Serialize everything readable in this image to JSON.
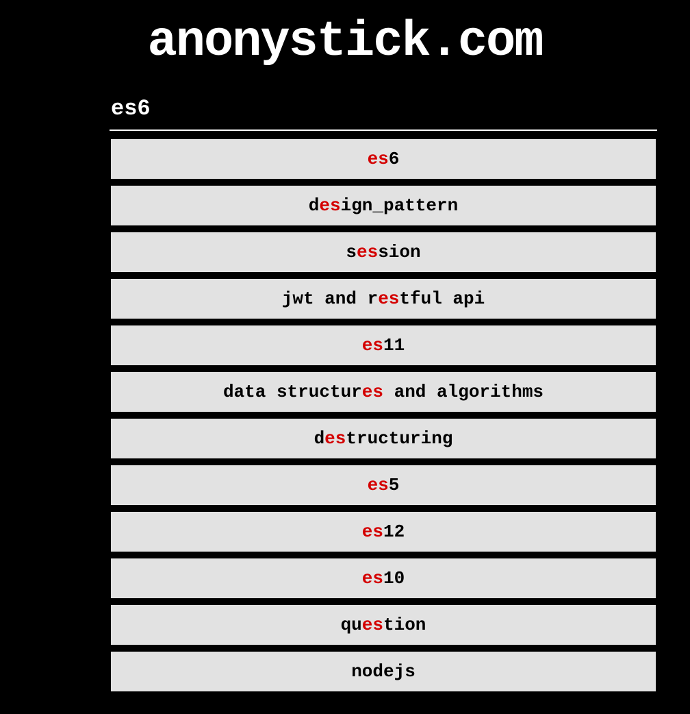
{
  "header": {
    "title": "anonystick.com"
  },
  "search": {
    "query": "es6",
    "highlight": "es"
  },
  "results": [
    {
      "text": "es6"
    },
    {
      "text": "design_pattern"
    },
    {
      "text": "session"
    },
    {
      "text": "jwt and restful api"
    },
    {
      "text": "es11"
    },
    {
      "text": "data structures and algorithms"
    },
    {
      "text": "destructuring"
    },
    {
      "text": "es5"
    },
    {
      "text": "es12"
    },
    {
      "text": "es10"
    },
    {
      "text": "question"
    },
    {
      "text": "nodejs"
    }
  ]
}
